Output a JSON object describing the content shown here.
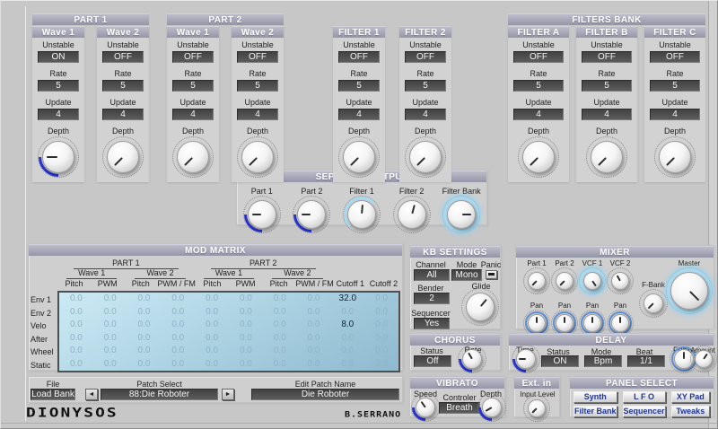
{
  "top": {
    "field_labels": {
      "unstable": "Unstable",
      "rate": "Rate",
      "update": "Update",
      "depth": "Depth"
    },
    "groups": [
      {
        "label": "PART 1",
        "modules": [
          {
            "label": "Wave 1",
            "unstable": "ON",
            "rate": "5",
            "update": "4",
            "knob": {
              "angle": -90,
              "arc": "blue-left"
            }
          },
          {
            "label": "Wave 2",
            "unstable": "OFF",
            "rate": "5",
            "update": "4",
            "knob": {
              "angle": -135,
              "arc": "none"
            }
          }
        ]
      },
      {
        "label": "PART 2",
        "modules": [
          {
            "label": "Wave 1",
            "unstable": "OFF",
            "rate": "5",
            "update": "4",
            "knob": {
              "angle": -135,
              "arc": "none"
            }
          },
          {
            "label": "Wave 2",
            "unstable": "OFF",
            "rate": "5",
            "update": "4",
            "knob": {
              "angle": -135,
              "arc": "none"
            }
          }
        ]
      },
      {
        "label": "",
        "modules": [
          {
            "label": "FILTER 1",
            "unstable": "OFF",
            "rate": "5",
            "update": "4",
            "knob": {
              "angle": -135,
              "arc": "none"
            }
          }
        ]
      },
      {
        "label": "",
        "modules": [
          {
            "label": "FILTER 2",
            "unstable": "OFF",
            "rate": "5",
            "update": "4",
            "knob": {
              "angle": -135,
              "arc": "none"
            }
          }
        ]
      },
      {
        "label": "FILTERS BANK",
        "modules": [
          {
            "label": "FILTER A",
            "unstable": "OFF",
            "rate": "5",
            "update": "4",
            "knob": {
              "angle": -135,
              "arc": "none"
            }
          },
          {
            "label": "FILTER B",
            "unstable": "OFF",
            "rate": "5",
            "update": "4",
            "knob": {
              "angle": -135,
              "arc": "none"
            }
          },
          {
            "label": "FILTER C",
            "unstable": "OFF",
            "rate": "5",
            "update": "4",
            "knob": {
              "angle": -135,
              "arc": "none"
            }
          }
        ]
      }
    ]
  },
  "separate_output": {
    "title": "SEPARATE OUTPUT",
    "knobs": [
      {
        "label": "Part 1",
        "angle": -90,
        "arc": "blue-left"
      },
      {
        "label": "Part 2",
        "angle": -90,
        "arc": "blue-left"
      },
      {
        "label": "Filter 1",
        "angle": 5,
        "arc": "cyan-half"
      },
      {
        "label": "Filter 2",
        "angle": 15,
        "arc": "none"
      },
      {
        "label": "Filter Bank",
        "angle": 90,
        "arc": "cyan-full"
      }
    ]
  },
  "mod_matrix": {
    "title": "MOD MATRIX",
    "parts": [
      "PART 1",
      "PART 2"
    ],
    "waves": [
      "Wave 1",
      "Wave 2",
      "Wave 1",
      "Wave 2"
    ],
    "columns": [
      "Pitch",
      "PWM",
      "Pitch",
      "PWM / FM",
      "Pitch",
      "PWM",
      "Pitch",
      "PWM / FM",
      "Cutoff 1",
      "Cutoff 2"
    ],
    "rows": [
      "Env 1",
      "Env 2",
      "Velo",
      "After",
      "Wheel",
      "Static"
    ],
    "cells": [
      [
        "0.0",
        "0.0",
        "0.0",
        "0.0",
        "0.0",
        "0.0",
        "0.0",
        "0.0",
        "32.0",
        "0.0"
      ],
      [
        "0.0",
        "0.0",
        "0.0",
        "0.0",
        "0.0",
        "0.0",
        "0.0",
        "0.0",
        "0.0",
        "0.0"
      ],
      [
        "0.0",
        "0.0",
        "0.0",
        "0.0",
        "0.0",
        "0.0",
        "0.0",
        "0.0",
        "8.0",
        "0.0"
      ],
      [
        "0.0",
        "0.0",
        "0.0",
        "0.0",
        "0.0",
        "0.0",
        "0.0",
        "0.0",
        "0.0",
        "0.0"
      ],
      [
        "0.0",
        "0.0",
        "0.0",
        "0.0",
        "0.0",
        "0.0",
        "0.0",
        "0.0",
        "0.0",
        "0.0"
      ],
      [
        "0.0",
        "0.0",
        "0.0",
        "0.0",
        "0.0",
        "0.0",
        "0.0",
        "0.0",
        "0.0",
        "0.0"
      ]
    ]
  },
  "kb_settings": {
    "title": "KB SETTINGS",
    "channel_label": "Channel",
    "channel": "All",
    "mode_label": "Mode",
    "mode": "Mono",
    "panic_label": "Panic",
    "bender_label": "Bender",
    "bender": "2",
    "glide_label": "Glide",
    "glide_knob": {
      "angle": 40,
      "arc": "none"
    },
    "sequencer_label": "Sequencer",
    "sequencer": "Yes"
  },
  "mixer": {
    "title": "MIXER",
    "pan_label": "Pan",
    "channels": [
      {
        "label": "Part 1",
        "knob": {
          "angle": -135,
          "arc": "none"
        },
        "pan": {
          "angle": 0,
          "arc": "blue-ring"
        }
      },
      {
        "label": "Part 2",
        "knob": {
          "angle": -135,
          "arc": "none"
        },
        "pan": {
          "angle": 0,
          "arc": "blue-ring"
        }
      },
      {
        "label": "VCF 1",
        "knob": {
          "angle": 145,
          "arc": "cyan-full"
        },
        "pan": {
          "angle": 0,
          "arc": "blue-ring"
        }
      },
      {
        "label": "VCF 2",
        "knob": {
          "angle": -30,
          "arc": "none"
        },
        "pan": {
          "angle": 0,
          "arc": "blue-ring"
        }
      }
    ],
    "fbank": {
      "label": "F-Bank",
      "knob": {
        "angle": -135,
        "arc": "none"
      }
    },
    "master": {
      "label": "Master",
      "knob": {
        "angle": 135,
        "arc": "cyan-full"
      }
    }
  },
  "chorus": {
    "title": "CHORUS",
    "status_label": "Status",
    "status": "Off",
    "rate_label": "Rate",
    "rate_knob": {
      "angle": -30,
      "arc": "blue-left"
    }
  },
  "delay": {
    "title": "DELAY",
    "time_label": "Time",
    "time_knob": {
      "angle": -90,
      "arc": "blue-left"
    },
    "status_label": "Status",
    "status": "ON",
    "mode_label": "Mode",
    "mode": "Bpm",
    "beat_label": "Beat",
    "beat": "1/1",
    "fdbk_label": "Fdbk",
    "fdbk_knob": {
      "angle": 0,
      "arc": "blue-ring"
    },
    "amount_label": "Amount",
    "amount_knob": {
      "angle": 35,
      "arc": "none"
    }
  },
  "file_bar": {
    "file_label": "File",
    "file_value": "Load Bank",
    "patch_label": "Patch Select",
    "patch_value": "88:Die Roboter",
    "edit_label": "Edit Patch Name",
    "edit_value": "Die Roboter",
    "prev_icon": "◄",
    "next_icon": "►"
  },
  "vibrato": {
    "title": "VIBRATO",
    "speed_label": "Speed",
    "speed_knob": {
      "angle": -35,
      "arc": "blue-left"
    },
    "controller_label": "Controler",
    "controller": "Breath",
    "depth_label": "Depth",
    "depth_knob": {
      "angle": -120,
      "arc": "blue-left"
    }
  },
  "ext_in": {
    "title": "Ext. in",
    "input_label": "Input Level",
    "knob": {
      "angle": -135,
      "arc": "none"
    }
  },
  "panel_select": {
    "title": "PANEL SELECT",
    "buttons": [
      "Synth",
      "L F O",
      "XY Pad",
      "Filter Bank",
      "Sequencer",
      "Tweaks"
    ]
  },
  "branding": {
    "logo": "DIONYSOS",
    "author": "B.SERRANO"
  }
}
